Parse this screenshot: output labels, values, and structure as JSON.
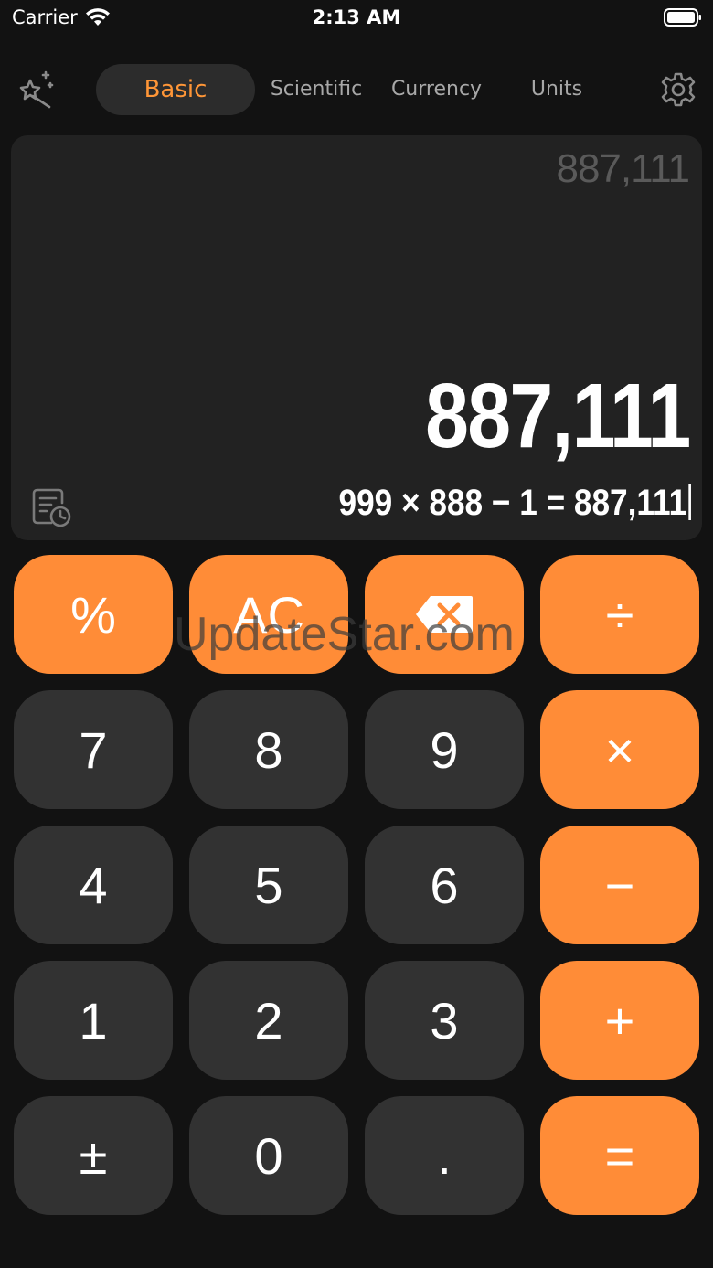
{
  "status_bar": {
    "carrier": "Carrier",
    "time": "2:13 AM"
  },
  "nav": {
    "tabs": [
      "Basic",
      "Scientific",
      "Currency",
      "Units"
    ],
    "active_tab": "Basic",
    "icons": [
      "magic-wand-icon",
      "gear-icon"
    ]
  },
  "display": {
    "previous_result": "887,111",
    "result": "887,111",
    "expression": "999 × 888 − 1 = 887,111",
    "history_icon": "history-icon"
  },
  "keypad": {
    "percent": "%",
    "clear": "AC",
    "backspace_icon": "backspace-icon",
    "divide": "÷",
    "multiply": "×",
    "minus": "−",
    "plus": "+",
    "equals": "=",
    "seven": "7",
    "eight": "8",
    "nine": "9",
    "four": "4",
    "five": "5",
    "six": "6",
    "one": "1",
    "two": "2",
    "three": "3",
    "plus_minus": "±",
    "zero": "0",
    "decimal": "."
  },
  "watermark": "UpdateStar.com",
  "colors": {
    "background": "#121212",
    "panel": "#222222",
    "key": "#323232",
    "accent": "#ff8c37",
    "active_tab_text": "#ff9637"
  }
}
